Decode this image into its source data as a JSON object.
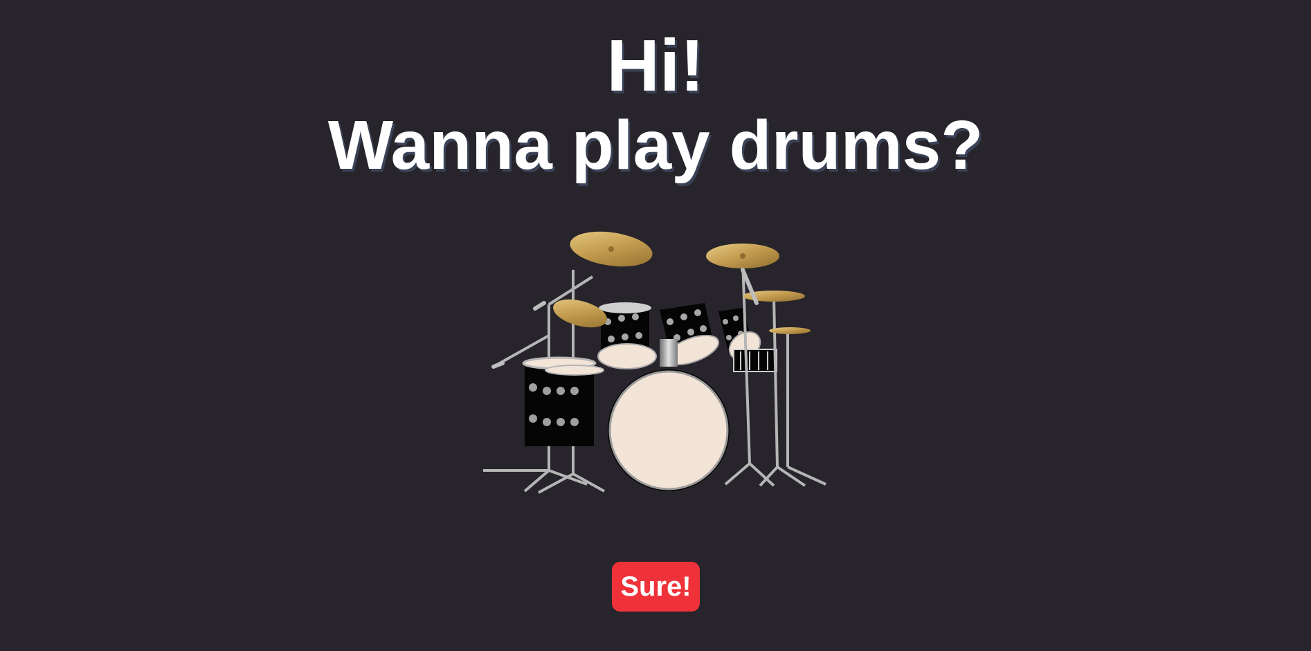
{
  "header": {
    "line1": "Hi!",
    "line2": "Wanna play drums?"
  },
  "illustration": {
    "name": "drum-kit",
    "icon": "drum-kit-icon"
  },
  "cta": {
    "label": "Sure!"
  },
  "colors": {
    "background": "#27242b",
    "heading_text": "#ffffff",
    "heading_shadow": "#3a4257",
    "button_background": "#ef3239",
    "button_text": "#ffffff",
    "cymbal": "#c9a85c",
    "drum_head": "#f3e4d8",
    "drum_shell": "#0a0a0a",
    "hardware": "#a7a7a7"
  }
}
